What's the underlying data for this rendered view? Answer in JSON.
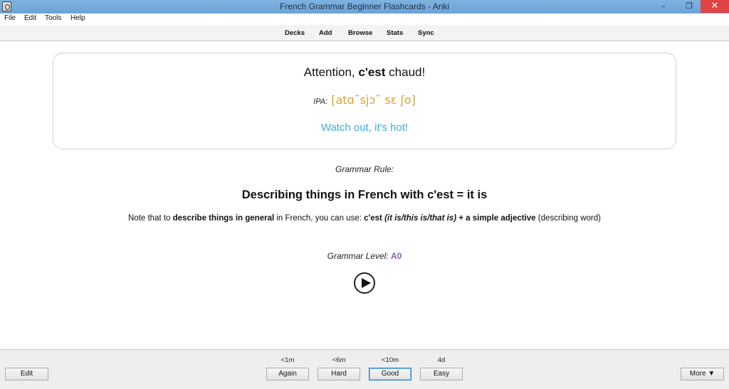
{
  "window": {
    "title": "French Grammar Beginner Flashcards - Anki",
    "minimize_glyph": "–",
    "maximize_glyph": "❐",
    "close_glyph": "✕"
  },
  "menu": {
    "file": "File",
    "edit": "Edit",
    "tools": "Tools",
    "help": "Help"
  },
  "toolbar": {
    "decks": "Decks",
    "add": "Add",
    "browse": "Browse",
    "stats": "Stats",
    "sync": "Sync"
  },
  "card": {
    "front_pre": "Attention, ",
    "front_bold": "c'est",
    "front_post": " chaud!",
    "ipa_label": "IPA:",
    "ipa_value": "[atɑ˜sjɔ˜ sɛ ʃo]",
    "translation": "Watch out, it's hot!"
  },
  "grammar": {
    "rule_label": "Grammar Rule:",
    "rule_title": "Describing things in French with c'est = it is",
    "note_1": "Note that to ",
    "note_2_bold": "describe things in general",
    "note_3": " in French, you can use: ",
    "note_4_bold": "c'est ",
    "note_5_bolditalic": "(it is/this is/that is)",
    "note_6_bold": " + a simple adjective",
    "note_7": " (describing word)",
    "level_label": "Grammar Level: ",
    "level_value": "A0"
  },
  "audio": {
    "icon": "play-icon"
  },
  "bottom": {
    "edit": "Edit",
    "more": "More ▼",
    "again": "Again",
    "hard": "Hard",
    "good": "Good",
    "easy": "Easy",
    "again_interval": "<1m",
    "hard_interval": "<6m",
    "good_interval": "<10m",
    "easy_interval": "4d"
  },
  "colors": {
    "titlebar": "#6fa8dc",
    "ipa": "#d4a23a",
    "translation": "#3ab0d6",
    "level": "#8a5fb8",
    "close_button": "#e04343"
  }
}
